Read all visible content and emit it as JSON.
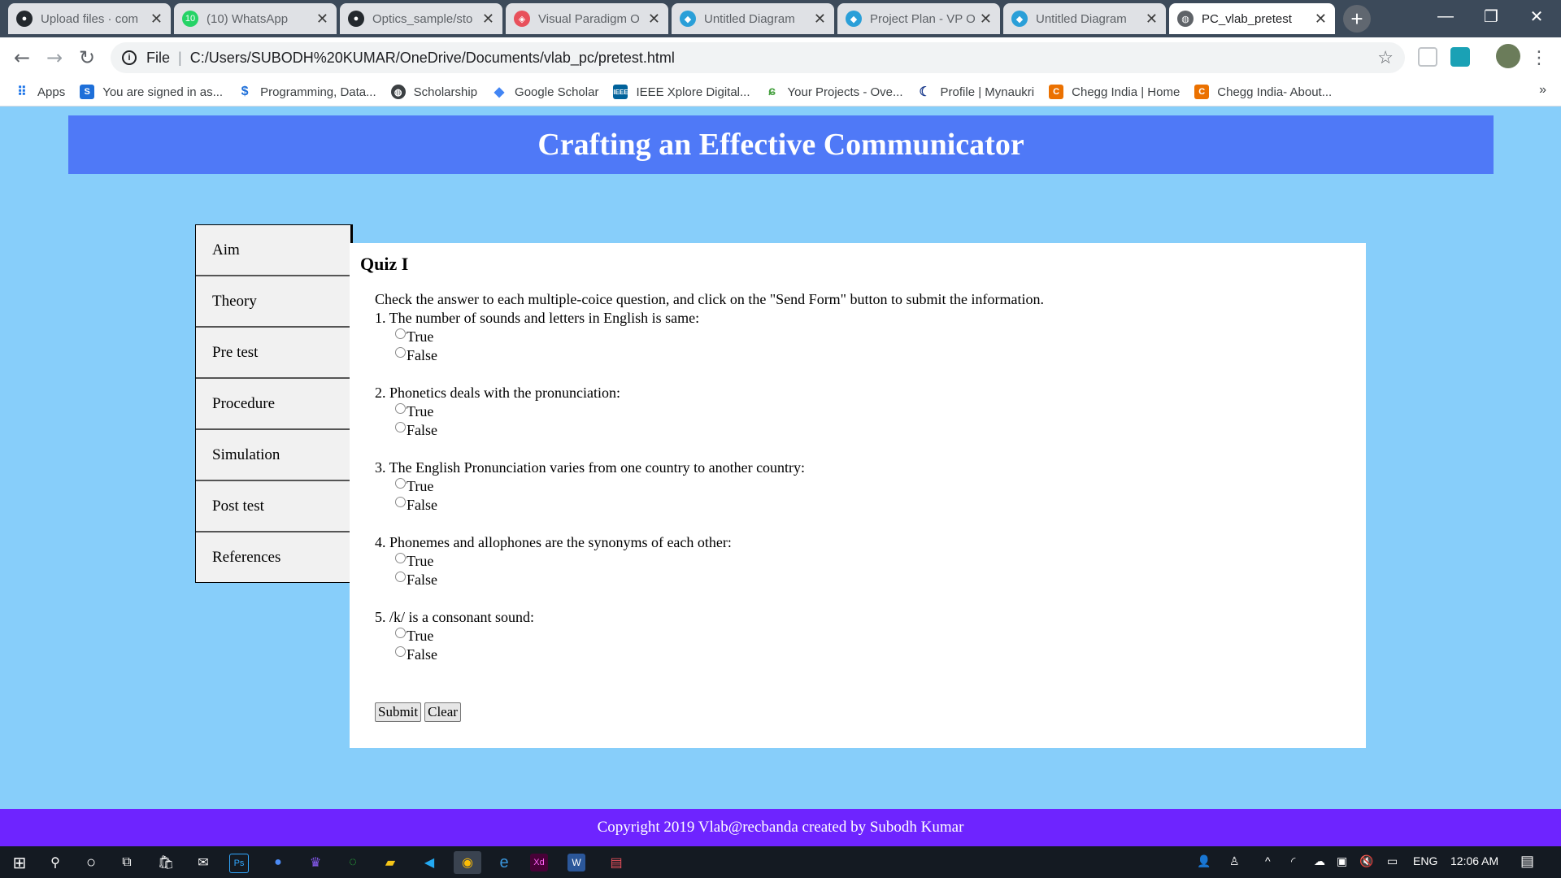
{
  "browser": {
    "tabs": [
      {
        "title": "Upload files · com",
        "icon": "github-icon"
      },
      {
        "title": "(10) WhatsApp",
        "icon": "whatsapp-icon"
      },
      {
        "title": "Optics_sample/sto",
        "icon": "github-icon"
      },
      {
        "title": "Visual Paradigm O",
        "icon": "visual-paradigm-icon"
      },
      {
        "title": "Untitled Diagram",
        "icon": "drawio-icon"
      },
      {
        "title": "Project Plan - VP O",
        "icon": "drawio-icon"
      },
      {
        "title": "Untitled Diagram",
        "icon": "drawio-icon"
      },
      {
        "title": "PC_vlab_pretest",
        "icon": "globe-icon",
        "active": true
      }
    ],
    "newtab_label": "+",
    "window_controls": {
      "minimize": "—",
      "restore": "❐",
      "close": "✕"
    },
    "address": {
      "scheme": "File",
      "url": "C:/Users/SUBODH%20KUMAR/OneDrive/Documents/vlab_pc/pretest.html"
    },
    "bookmarks": [
      {
        "label": "Apps",
        "icon": "apps-grid-icon"
      },
      {
        "label": "You are signed in as...",
        "icon": "s-brand-icon"
      },
      {
        "label": "Programming, Data...",
        "icon": "dollar-s-icon"
      },
      {
        "label": "Scholarship",
        "icon": "globe-icon"
      },
      {
        "label": "Google Scholar",
        "icon": "scholar-cap-icon"
      },
      {
        "label": "IEEE Xplore Digital...",
        "icon": "ieee-icon"
      },
      {
        "label": "Your Projects - Ove...",
        "icon": "overleaf-icon"
      },
      {
        "label": "Profile | Mynaukri",
        "icon": "naukri-icon"
      },
      {
        "label": "Chegg India | Home",
        "icon": "chegg-icon"
      },
      {
        "label": "Chegg India- About...",
        "icon": "chegg-icon"
      }
    ],
    "bookmarks_more": "»"
  },
  "page": {
    "header": "Crafting an Effective Communicator",
    "nav": [
      "Aim",
      "Theory",
      "Pre test",
      "Procedure",
      "Simulation",
      "Post test",
      "References"
    ],
    "quiz_title": "Quiz I",
    "instructions": "Check the answer to each multiple-coice question, and click on the \"Send Form\" button to submit the information.",
    "questions": [
      {
        "text": "1. The number of sounds and letters in English is same:",
        "options": [
          "True",
          "False"
        ]
      },
      {
        "text": "2. Phonetics deals with the pronunciation:",
        "options": [
          "True",
          "False"
        ]
      },
      {
        "text": "3. The English Pronunciation varies from one country to another country:",
        "options": [
          "True",
          "False"
        ]
      },
      {
        "text": "4. Phonemes and allophones are the synonyms of each other:",
        "options": [
          "True",
          "False"
        ]
      },
      {
        "text": "5. /k/ is a consonant sound:",
        "options": [
          "True",
          "False"
        ]
      }
    ],
    "submit_label": "Submit",
    "clear_label": "Clear",
    "footer": "Copyright 2019 Vlab@recbanda created by Subodh Kumar"
  },
  "taskbar": {
    "language": "ENG",
    "time": "12:06 AM"
  },
  "colors": {
    "page_bg": "#87cefa",
    "header_bg": "#4f79f7",
    "footer_bg": "#6e24ff"
  }
}
